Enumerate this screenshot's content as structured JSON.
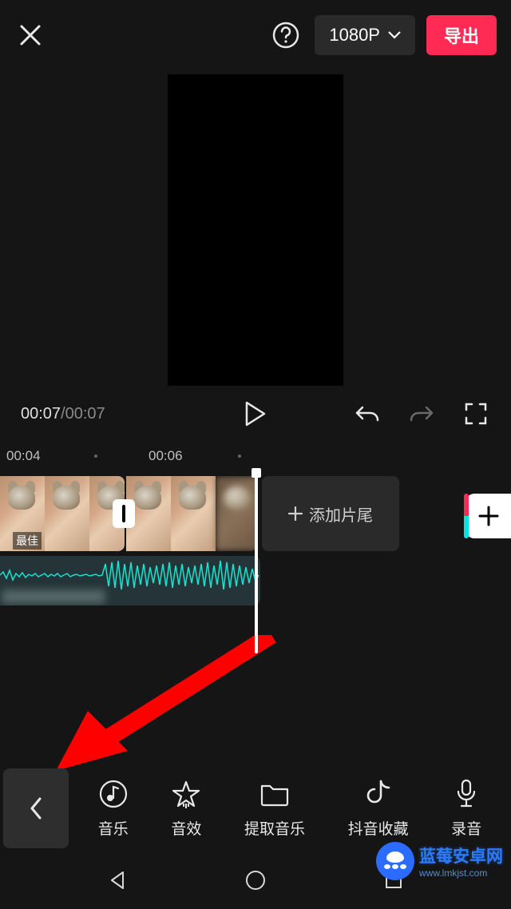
{
  "topbar": {
    "resolution_label": "1080P",
    "export_label": "导出"
  },
  "playback": {
    "current_time": "00:07",
    "duration": "00:07"
  },
  "ruler": {
    "ticks": [
      "00:04",
      "00:06"
    ]
  },
  "video_track": {
    "clip_caption": "最佳",
    "add_end_label": "添加片尾"
  },
  "toolbar": {
    "items": [
      {
        "icon": "music-note-icon",
        "label": "音乐"
      },
      {
        "icon": "star-icon",
        "label": "音效"
      },
      {
        "icon": "folder-icon",
        "label": "提取音乐"
      },
      {
        "icon": "douyin-icon",
        "label": "抖音收藏"
      },
      {
        "icon": "microphone-icon",
        "label": "录音"
      }
    ]
  },
  "watermark": {
    "title": "蓝莓安卓网",
    "url": "www.lmkjst.com"
  }
}
